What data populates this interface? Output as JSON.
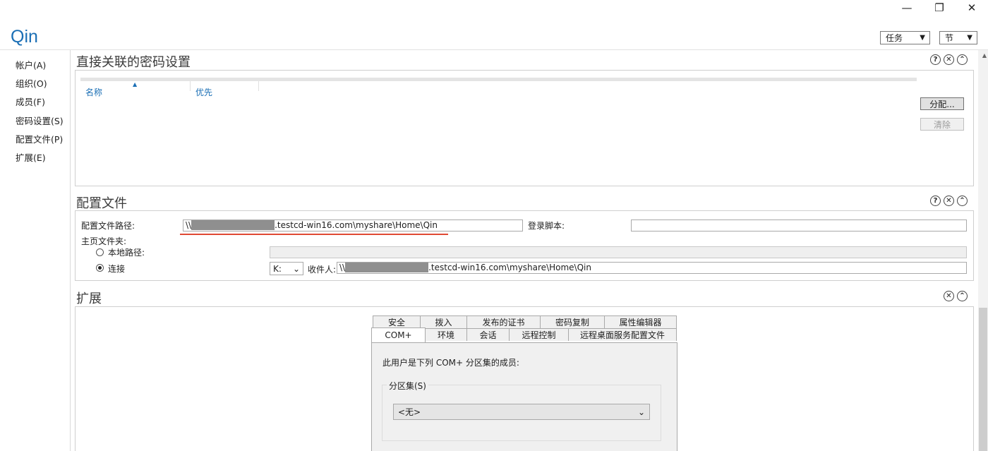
{
  "window": {
    "minimize": "—",
    "restore": "❐",
    "close": "✕",
    "title": "Qin"
  },
  "toolbar": {
    "tasks_label": "任务",
    "sections_label": "节",
    "arrow": "▼"
  },
  "nav": {
    "items": [
      {
        "label": "帐户(A)"
      },
      {
        "label": "组织(O)"
      },
      {
        "label": "成员(F)"
      },
      {
        "label": "密码设置(S)"
      },
      {
        "label": "配置文件(P)"
      },
      {
        "label": "扩展(E)"
      }
    ]
  },
  "icons": {
    "help": "?",
    "close": "✕",
    "collapse": "⌃"
  },
  "password": {
    "title": "直接关联的密码设置",
    "columns": [
      "名称",
      "优先"
    ],
    "sort_arrow": "▲",
    "assign_button": "分配...",
    "clear_button": "清除"
  },
  "profile": {
    "title": "配置文件",
    "path_label": "配置文件路径:",
    "path_prefix": "\\\\",
    "path_suffix": ".testcd-win16.com\\myshare\\Home\\Qin",
    "logon_label": "登录脚本:",
    "logon_value": "",
    "home_label": "主页文件夹:",
    "local_label": "本地路径:",
    "connect_label": "连接",
    "drive": "K:",
    "drive_arrow": "⌄",
    "to_label": "收件人:",
    "to_prefix": "\\\\",
    "to_suffix": ".testcd-win16.com\\myshare\\Home\\Qin"
  },
  "extensions": {
    "title": "扩展",
    "tabs_row1": [
      "安全",
      "拨入",
      "发布的证书",
      "密码复制",
      "属性编辑器"
    ],
    "tabs_row2": [
      "COM+",
      "环境",
      "会话",
      "远程控制",
      "远程桌面服务配置文件"
    ],
    "active_tab": "COM+",
    "description": "此用户是下列 COM+ 分区集的成员:",
    "group_title": "分区集(S)",
    "combo_value": "<无>",
    "combo_arrow": "⌄"
  },
  "colors": {
    "accent": "#1b6fb5",
    "underline": "#e04a34"
  }
}
